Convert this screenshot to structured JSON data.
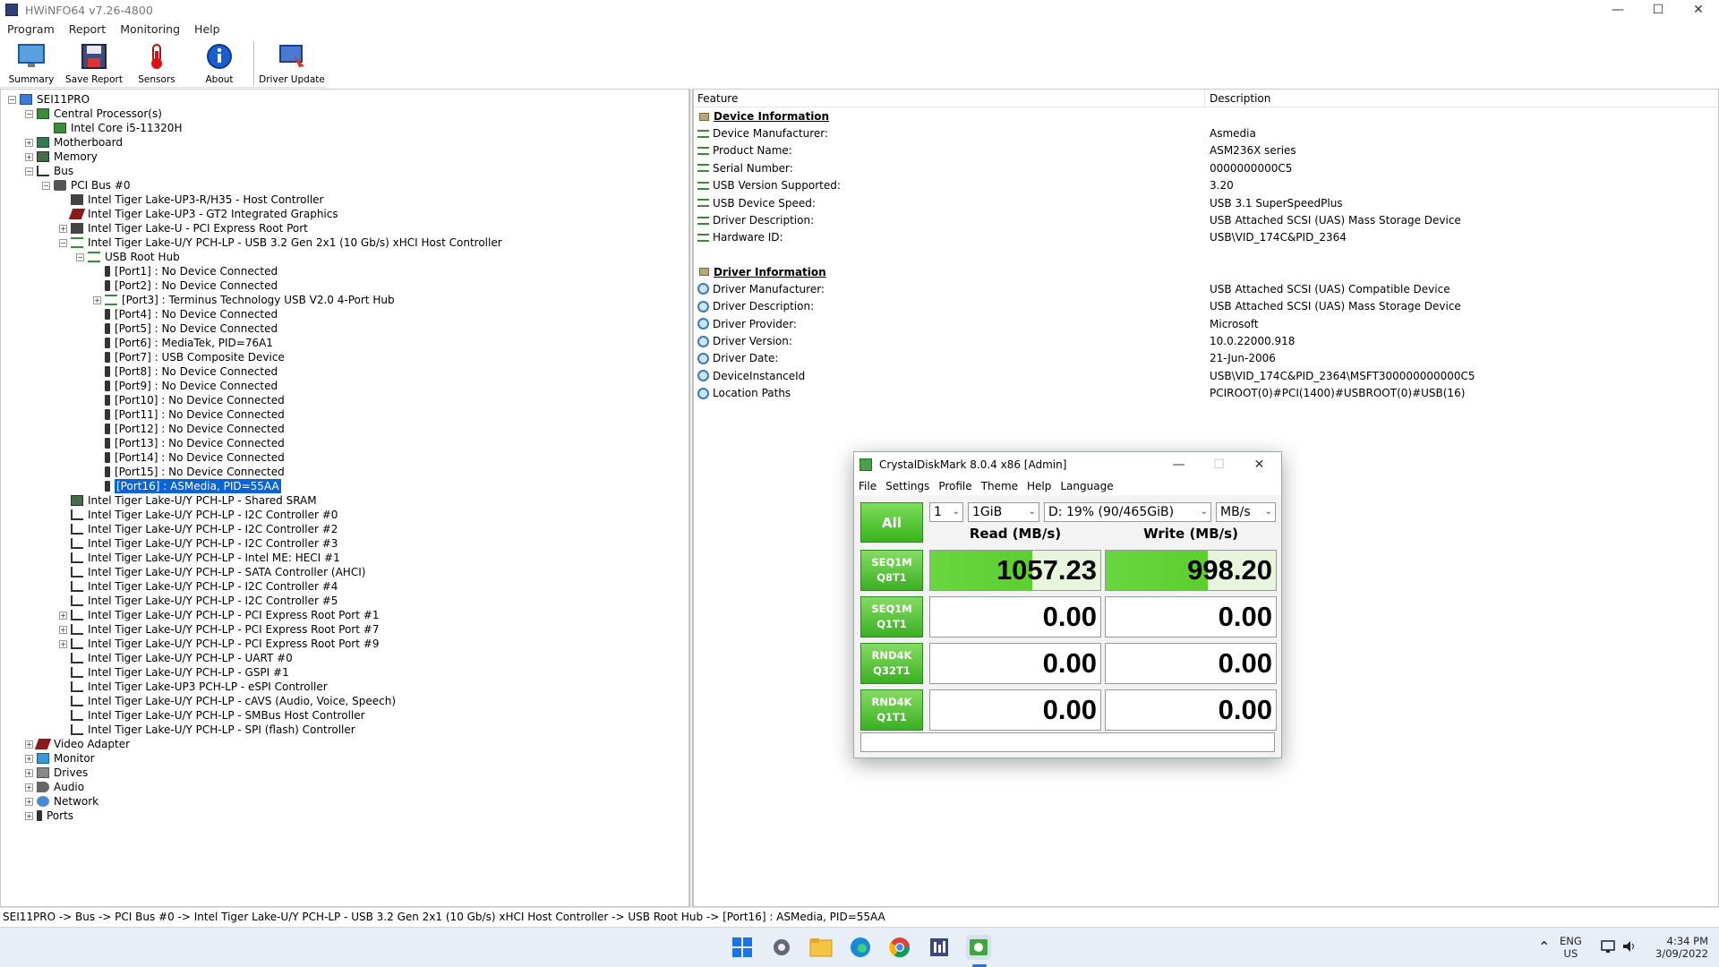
{
  "app": {
    "title": "HWiNFO64 v7.26-4800"
  },
  "menu": [
    "Program",
    "Report",
    "Monitoring",
    "Help"
  ],
  "toolbar": {
    "summary": "Summary",
    "save_report": "Save Report",
    "sensors": "Sensors",
    "about": "About",
    "driver_update": "Driver Update"
  },
  "tree": {
    "root": "SEI11PRO",
    "cpu_group": "Central Processor(s)",
    "cpu": "Intel Core i5-11320H",
    "motherboard": "Motherboard",
    "memory": "Memory",
    "bus": "Bus",
    "pci_bus": "PCI Bus #0",
    "host_controller": "Intel Tiger Lake-UP3-R/H35 - Host Controller",
    "graphics": "Intel Tiger Lake-UP3 - GT2 Integrated Graphics",
    "pcie_root": "Intel Tiger Lake-U - PCI Express Root Port",
    "xhci": "Intel Tiger Lake-U/Y PCH-LP - USB 3.2 Gen 2x1 (10 Gb/s) xHCI Host Controller",
    "usb_root_hub": "USB Root Hub",
    "ports": [
      "[Port1] : No Device Connected",
      "[Port2] : No Device Connected",
      "[Port3] : Terminus Technology USB V2.0 4-Port Hub",
      "[Port4] : No Device Connected",
      "[Port5] : No Device Connected",
      "[Port6] : MediaTek, PID=76A1",
      "[Port7] : USB Composite Device",
      "[Port8] : No Device Connected",
      "[Port9] : No Device Connected",
      "[Port10] : No Device Connected",
      "[Port11] : No Device Connected",
      "[Port12] : No Device Connected",
      "[Port13] : No Device Connected",
      "[Port14] : No Device Connected",
      "[Port15] : No Device Connected",
      "[Port16] : ASMedia, PID=55AA"
    ],
    "pch_devices": [
      "Intel Tiger Lake-U/Y PCH-LP - Shared SRAM",
      "Intel Tiger Lake-U/Y PCH-LP - I2C Controller #0",
      "Intel Tiger Lake-U/Y PCH-LP - I2C Controller #2",
      "Intel Tiger Lake-U/Y PCH-LP - I2C Controller #3",
      "Intel Tiger Lake-U/Y PCH-LP - Intel ME: HECI #1",
      "Intel Tiger Lake-U/Y PCH-LP - SATA Controller (AHCI)",
      "Intel Tiger Lake-U/Y PCH-LP - I2C Controller #4",
      "Intel Tiger Lake-U/Y PCH-LP - I2C Controller #5",
      "Intel Tiger Lake-U/Y PCH-LP - PCI Express Root Port #1",
      "Intel Tiger Lake-U/Y PCH-LP - PCI Express Root Port #7",
      "Intel Tiger Lake-U/Y PCH-LP - PCI Express Root Port #9",
      "Intel Tiger Lake-U/Y PCH-LP - UART #0",
      "Intel Tiger Lake-U/Y PCH-LP - GSPI #1",
      "Intel Tiger Lake-UP3 PCH-LP - eSPI Controller",
      "Intel Tiger Lake-U/Y PCH-LP - cAVS (Audio, Voice, Speech)",
      "Intel Tiger Lake-U/Y PCH-LP - SMBus Host Controller",
      "Intel Tiger Lake-U/Y PCH-LP - SPI (flash) Controller"
    ],
    "video_adapter": "Video Adapter",
    "monitor": "Monitor",
    "drives": "Drives",
    "audio": "Audio",
    "network": "Network",
    "ports_group": "Ports"
  },
  "details": {
    "col_feature": "Feature",
    "col_description": "Description",
    "device_section": "Device Information",
    "device_rows": [
      {
        "feature": "Device Manufacturer:",
        "value": "Asmedia"
      },
      {
        "feature": "Product Name:",
        "value": "ASM236X series"
      },
      {
        "feature": "Serial Number:",
        "value": "0000000000C5"
      },
      {
        "feature": "USB Version Supported:",
        "value": "3.20"
      },
      {
        "feature": "USB Device Speed:",
        "value": "USB 3.1 SuperSpeedPlus"
      },
      {
        "feature": "Driver Description:",
        "value": "USB Attached SCSI (UAS) Mass Storage Device"
      },
      {
        "feature": "Hardware ID:",
        "value": "USB\\VID_174C&PID_2364"
      }
    ],
    "driver_section": "Driver Information",
    "driver_rows": [
      {
        "feature": "Driver Manufacturer:",
        "value": "USB Attached SCSI (UAS) Compatible Device"
      },
      {
        "feature": "Driver Description:",
        "value": "USB Attached SCSI (UAS) Mass Storage Device"
      },
      {
        "feature": "Driver Provider:",
        "value": "Microsoft"
      },
      {
        "feature": "Driver Version:",
        "value": "10.0.22000.918"
      },
      {
        "feature": "Driver Date:",
        "value": "21-Jun-2006"
      },
      {
        "feature": "DeviceInstanceId",
        "value": "USB\\VID_174C&PID_2364\\MSFT300000000000C5"
      },
      {
        "feature": "Location Paths",
        "value": "PCIROOT(0)#PCI(1400)#USBROOT(0)#USB(16)"
      }
    ]
  },
  "statusbar": "SEI11PRO -> Bus -> PCI Bus #0 -> Intel Tiger Lake-U/Y PCH-LP - USB 3.2 Gen 2x1 (10 Gb/s) xHCI Host Controller -> USB Root Hub -> [Port16] : ASMedia, PID=55AA",
  "cdm": {
    "title": "CrystalDiskMark 8.0.4 x86 [Admin]",
    "menu": [
      "File",
      "Settings",
      "Profile",
      "Theme",
      "Help",
      "Language"
    ],
    "all_label": "All",
    "count": "1",
    "size": "1GiB",
    "drive": "D: 19% (90/465GiB)",
    "unit": "MB/s",
    "read_head": "Read (MB/s)",
    "write_head": "Write (MB/s)",
    "tests": [
      {
        "l1": "SEQ1M",
        "l2": "Q8T1",
        "read": "1057.23",
        "write": "998.20"
      },
      {
        "l1": "SEQ1M",
        "l2": "Q1T1",
        "read": "0.00",
        "write": "0.00"
      },
      {
        "l1": "RND4K",
        "l2": "Q32T1",
        "read": "0.00",
        "write": "0.00"
      },
      {
        "l1": "RND4K",
        "l2": "Q1T1",
        "read": "0.00",
        "write": "0.00"
      }
    ]
  },
  "tray": {
    "lang1": "ENG",
    "lang2": "US",
    "time": "4:34 PM",
    "date": "3/09/2022"
  }
}
